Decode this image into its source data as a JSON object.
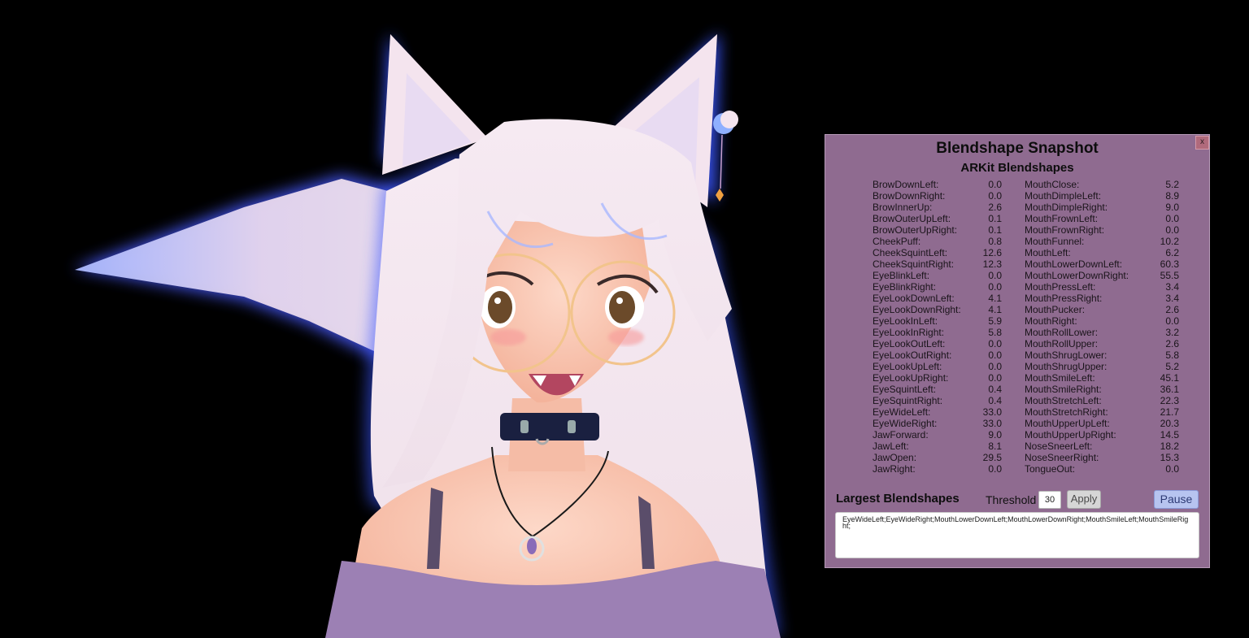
{
  "panel": {
    "title": "Blendshape Snapshot",
    "subtitle": "ARKit Blendshapes",
    "close_label": "x",
    "left_column": [
      {
        "name": "BrowDownLeft:",
        "value": "0.0"
      },
      {
        "name": "BrowDownRight:",
        "value": "0.0"
      },
      {
        "name": "BrowInnerUp:",
        "value": "2.6"
      },
      {
        "name": "BrowOuterUpLeft:",
        "value": "0.1"
      },
      {
        "name": "BrowOuterUpRight:",
        "value": "0.1"
      },
      {
        "name": "CheekPuff:",
        "value": "0.8"
      },
      {
        "name": "CheekSquintLeft:",
        "value": "12.6"
      },
      {
        "name": "CheekSquintRight:",
        "value": "12.3"
      },
      {
        "name": "EyeBlinkLeft:",
        "value": "0.0"
      },
      {
        "name": "EyeBlinkRight:",
        "value": "0.0"
      },
      {
        "name": "EyeLookDownLeft:",
        "value": "4.1"
      },
      {
        "name": "EyeLookDownRight:",
        "value": "4.1"
      },
      {
        "name": "EyeLookInLeft:",
        "value": "5.9"
      },
      {
        "name": "EyeLookInRight:",
        "value": "5.8"
      },
      {
        "name": "EyeLookOutLeft:",
        "value": "0.0"
      },
      {
        "name": "EyeLookOutRight:",
        "value": "0.0"
      },
      {
        "name": "EyeLookUpLeft:",
        "value": "0.0"
      },
      {
        "name": "EyeLookUpRight:",
        "value": "0.0"
      },
      {
        "name": "EyeSquintLeft:",
        "value": "0.4"
      },
      {
        "name": "EyeSquintRight:",
        "value": "0.4"
      },
      {
        "name": "EyeWideLeft:",
        "value": "33.0"
      },
      {
        "name": "EyeWideRight:",
        "value": "33.0"
      },
      {
        "name": "JawForward:",
        "value": "9.0"
      },
      {
        "name": "JawLeft:",
        "value": "8.1"
      },
      {
        "name": "JawOpen:",
        "value": "29.5"
      },
      {
        "name": "JawRight:",
        "value": "0.0"
      }
    ],
    "right_column": [
      {
        "name": "MouthClose:",
        "value": "5.2"
      },
      {
        "name": "MouthDimpleLeft:",
        "value": "8.9"
      },
      {
        "name": "MouthDimpleRight:",
        "value": "9.0"
      },
      {
        "name": "MouthFrownLeft:",
        "value": "0.0"
      },
      {
        "name": "MouthFrownRight:",
        "value": "0.0"
      },
      {
        "name": "MouthFunnel:",
        "value": "10.2"
      },
      {
        "name": "MouthLeft:",
        "value": "6.2"
      },
      {
        "name": "MouthLowerDownLeft:",
        "value": "60.3"
      },
      {
        "name": "MouthLowerDownRight:",
        "value": "55.5"
      },
      {
        "name": "MouthPressLeft:",
        "value": "3.4"
      },
      {
        "name": "MouthPressRight:",
        "value": "3.4"
      },
      {
        "name": "MouthPucker:",
        "value": "2.6"
      },
      {
        "name": "MouthRight:",
        "value": "0.0"
      },
      {
        "name": "MouthRollLower:",
        "value": "3.2"
      },
      {
        "name": "MouthRollUpper:",
        "value": "2.6"
      },
      {
        "name": "MouthShrugLower:",
        "value": "5.8"
      },
      {
        "name": "MouthShrugUpper:",
        "value": "5.2"
      },
      {
        "name": "MouthSmileLeft:",
        "value": "45.1"
      },
      {
        "name": "MouthSmileRight:",
        "value": "36.1"
      },
      {
        "name": "MouthStretchLeft:",
        "value": "22.3"
      },
      {
        "name": "MouthStretchRight:",
        "value": "21.7"
      },
      {
        "name": "MouthUpperUpLeft:",
        "value": "20.3"
      },
      {
        "name": "MouthUpperUpRight:",
        "value": "14.5"
      },
      {
        "name": "NoseSneerLeft:",
        "value": "18.2"
      },
      {
        "name": "NoseSneerRight:",
        "value": "15.3"
      },
      {
        "name": "TongueOut:",
        "value": "0.0"
      }
    ],
    "largest_label": "Largest Blendshapes",
    "threshold_label": "Threshold",
    "threshold_value": "30",
    "apply_label": "Apply",
    "pause_label": "Pause",
    "largest_result": "EyeWideLeft;EyeWideRight;MouthLowerDownLeft;MouthLowerDownRight;MouthSmileLeft;MouthSmileRight;"
  },
  "colors": {
    "background": "#000000",
    "panel_bg": "#8f6b90",
    "pause_button": "#b7c4f0",
    "close_button": "#b06a7c",
    "sweater": "#9c80b4",
    "hair": "#f3e6ef",
    "glow": "#3f5bff"
  },
  "scene": {
    "icon": "vtuber-avatar"
  }
}
